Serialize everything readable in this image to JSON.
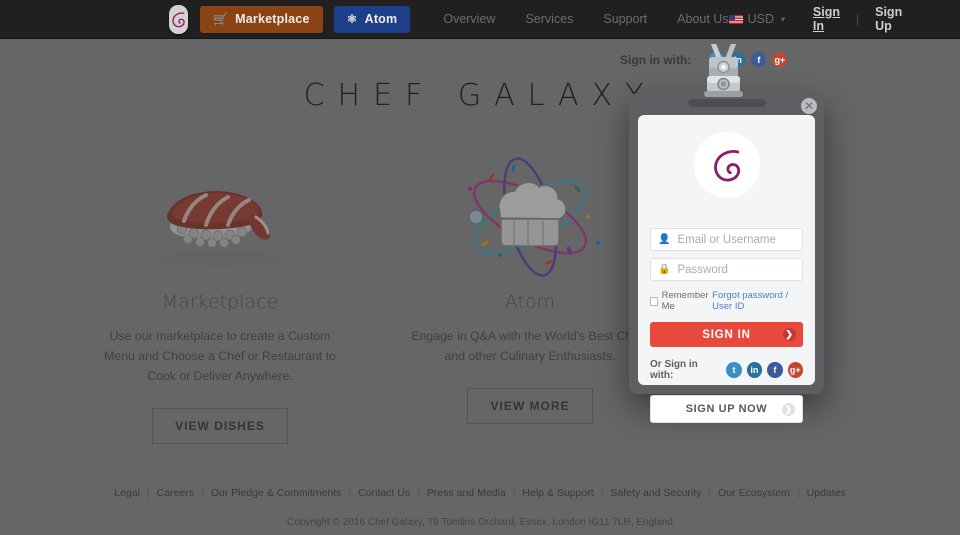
{
  "navbar": {
    "logo_icon": "chef-galaxy-logo",
    "marketplace": {
      "label": "Marketplace",
      "icon": "cart-icon",
      "glyph": "🛒",
      "color": "#8a4413"
    },
    "atom": {
      "label": "Atom",
      "icon": "atom-icon",
      "glyph": "⚛",
      "color": "#1d3f8a"
    },
    "links": [
      "Overview",
      "Services",
      "Support",
      "About Us"
    ],
    "currency": {
      "label": "USD",
      "icon": "us-flag-icon",
      "caret": "▼"
    },
    "sign_in": "Sign In",
    "separator": "|",
    "sign_up": "Sign Up"
  },
  "hero": {
    "title": "CHEF GALAXY",
    "columns": [
      {
        "art_icon": "sushi-illustration",
        "title": "Marketplace",
        "description": "Use our marketplace to create a Custom Menu and Choose a Chef or Restaurant to Cook or Deliver Anywhere.",
        "button": "VIEW DISHES"
      },
      {
        "art_icon": "chef-hat-atom-illustration",
        "title": "Atom",
        "description": "Engage in Q&A with the World's Best Chefs and other Culinary Enthusiasts.",
        "button": "VIEW MORE"
      }
    ]
  },
  "top_social": {
    "label": "Sign in with:",
    "icons": [
      {
        "name": "twitter-icon",
        "glyph": "t",
        "color": "#3b8fc4"
      },
      {
        "name": "linkedin-icon",
        "glyph": "in",
        "color": "#2b6f9c"
      },
      {
        "name": "facebook-icon",
        "glyph": "f",
        "color": "#3a5a9b"
      },
      {
        "name": "google-plus-icon",
        "glyph": "g+",
        "color": "#c5462f"
      }
    ]
  },
  "modal": {
    "clip_icon": "badge-lanyard-clip",
    "close_icon": "✕",
    "brand_icon": "chef-galaxy-logo",
    "username": {
      "placeholder": "Email or Username",
      "value": "",
      "icon": "user-icon"
    },
    "password": {
      "placeholder": "Password",
      "value": "",
      "icon": "lock-icon"
    },
    "remember_me": "Remember Me",
    "forgot": "Forgot password / User ID",
    "sign_in_button": "SIGN IN",
    "sign_in_arrow": "❯",
    "or_sign_in_with": "Or Sign in with:",
    "social": [
      {
        "name": "twitter-icon",
        "glyph": "t",
        "color": "#3b8fc4"
      },
      {
        "name": "linkedin-icon",
        "glyph": "in",
        "color": "#2b6f9c"
      },
      {
        "name": "facebook-icon",
        "glyph": "f",
        "color": "#3a5a9b"
      },
      {
        "name": "google-plus-icon",
        "glyph": "g+",
        "color": "#c5462f"
      }
    ],
    "sign_up_button": "SIGN UP NOW",
    "sign_up_arrow": "❯"
  },
  "footer": {
    "links": [
      "Legal",
      "Careers",
      "Our Pledge & Commitments",
      "Contact Us",
      "Press and Media",
      "Help & Support",
      "Safety and Security",
      "Our Ecosystem",
      "Updates"
    ],
    "separator": "|",
    "copyright": "Copyright © 2016 Chef Galaxy, 79 Tomlins Orchard, Essex, London IG11 7LR, England"
  }
}
